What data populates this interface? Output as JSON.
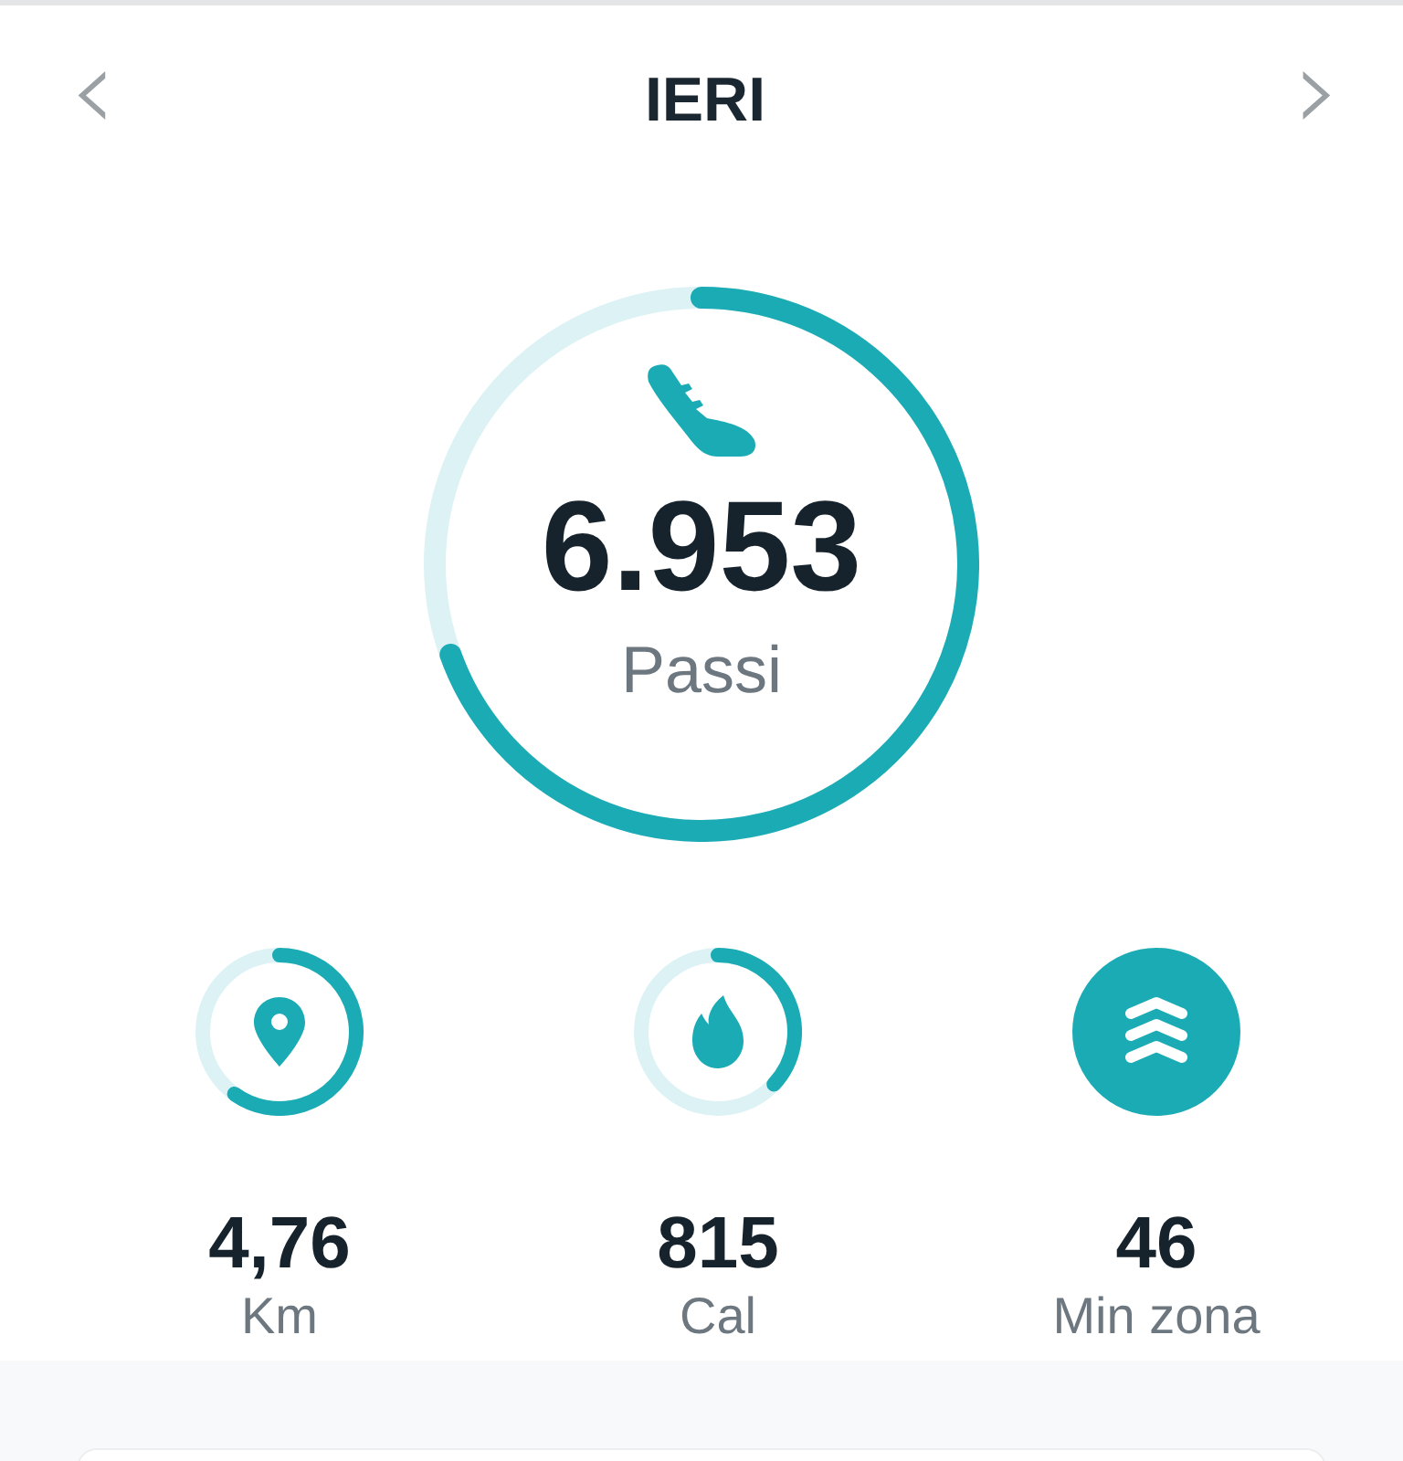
{
  "header": {
    "title": "IERI",
    "prev": "‹",
    "next": "›"
  },
  "main": {
    "value": "6.953",
    "label": "Passi"
  },
  "stats": [
    {
      "kind": "ring",
      "value": "4,76",
      "label": "Km"
    },
    {
      "kind": "ring",
      "value": "815",
      "label": "Cal"
    },
    {
      "kind": "badge",
      "value": "46",
      "label": "Min zona"
    }
  ]
}
